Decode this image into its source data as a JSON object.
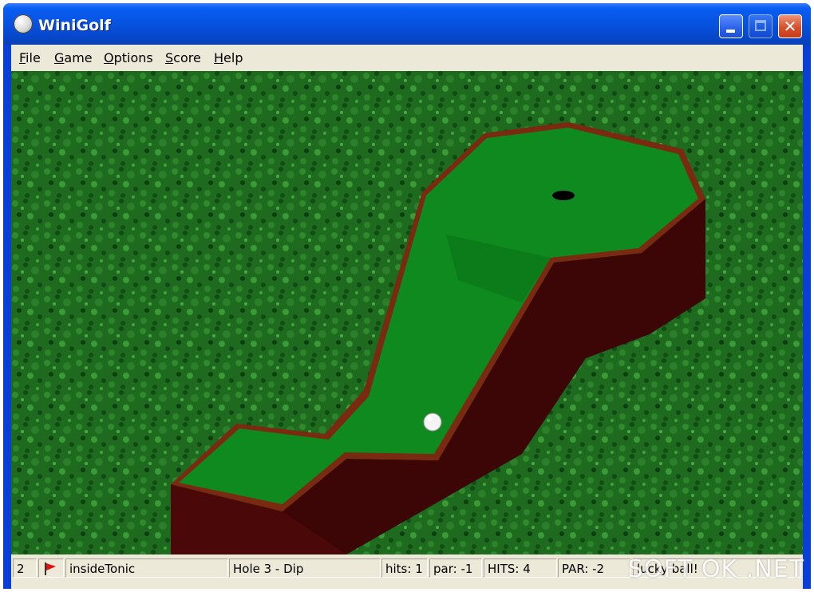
{
  "window": {
    "title": "WiniGolf"
  },
  "menu": {
    "file": {
      "ul": "F",
      "rest": "ile"
    },
    "game": {
      "ul": "G",
      "rest": "ame"
    },
    "options": {
      "ul": "O",
      "rest": "ptions"
    },
    "score": {
      "ul": "S",
      "rest": "core"
    },
    "help": {
      "ul": "H",
      "rest": "elp"
    }
  },
  "status": {
    "player_number": "2",
    "flag_icon": "red-flag-icon",
    "player_name": "insideTonic",
    "hole": "Hole 3 - Dip",
    "hits": "hits: 1",
    "par": "par: -1",
    "total_hits": "HITS: 4",
    "total_par": "PAR: -2",
    "message": "lucky ball!"
  },
  "colors": {
    "grass": "#1e6a1e",
    "green": "#0f8a1e",
    "rail": "#7a2a10",
    "wall": "#4a0808",
    "flag": "#e01010"
  },
  "watermark": "SOFT OK .NET"
}
